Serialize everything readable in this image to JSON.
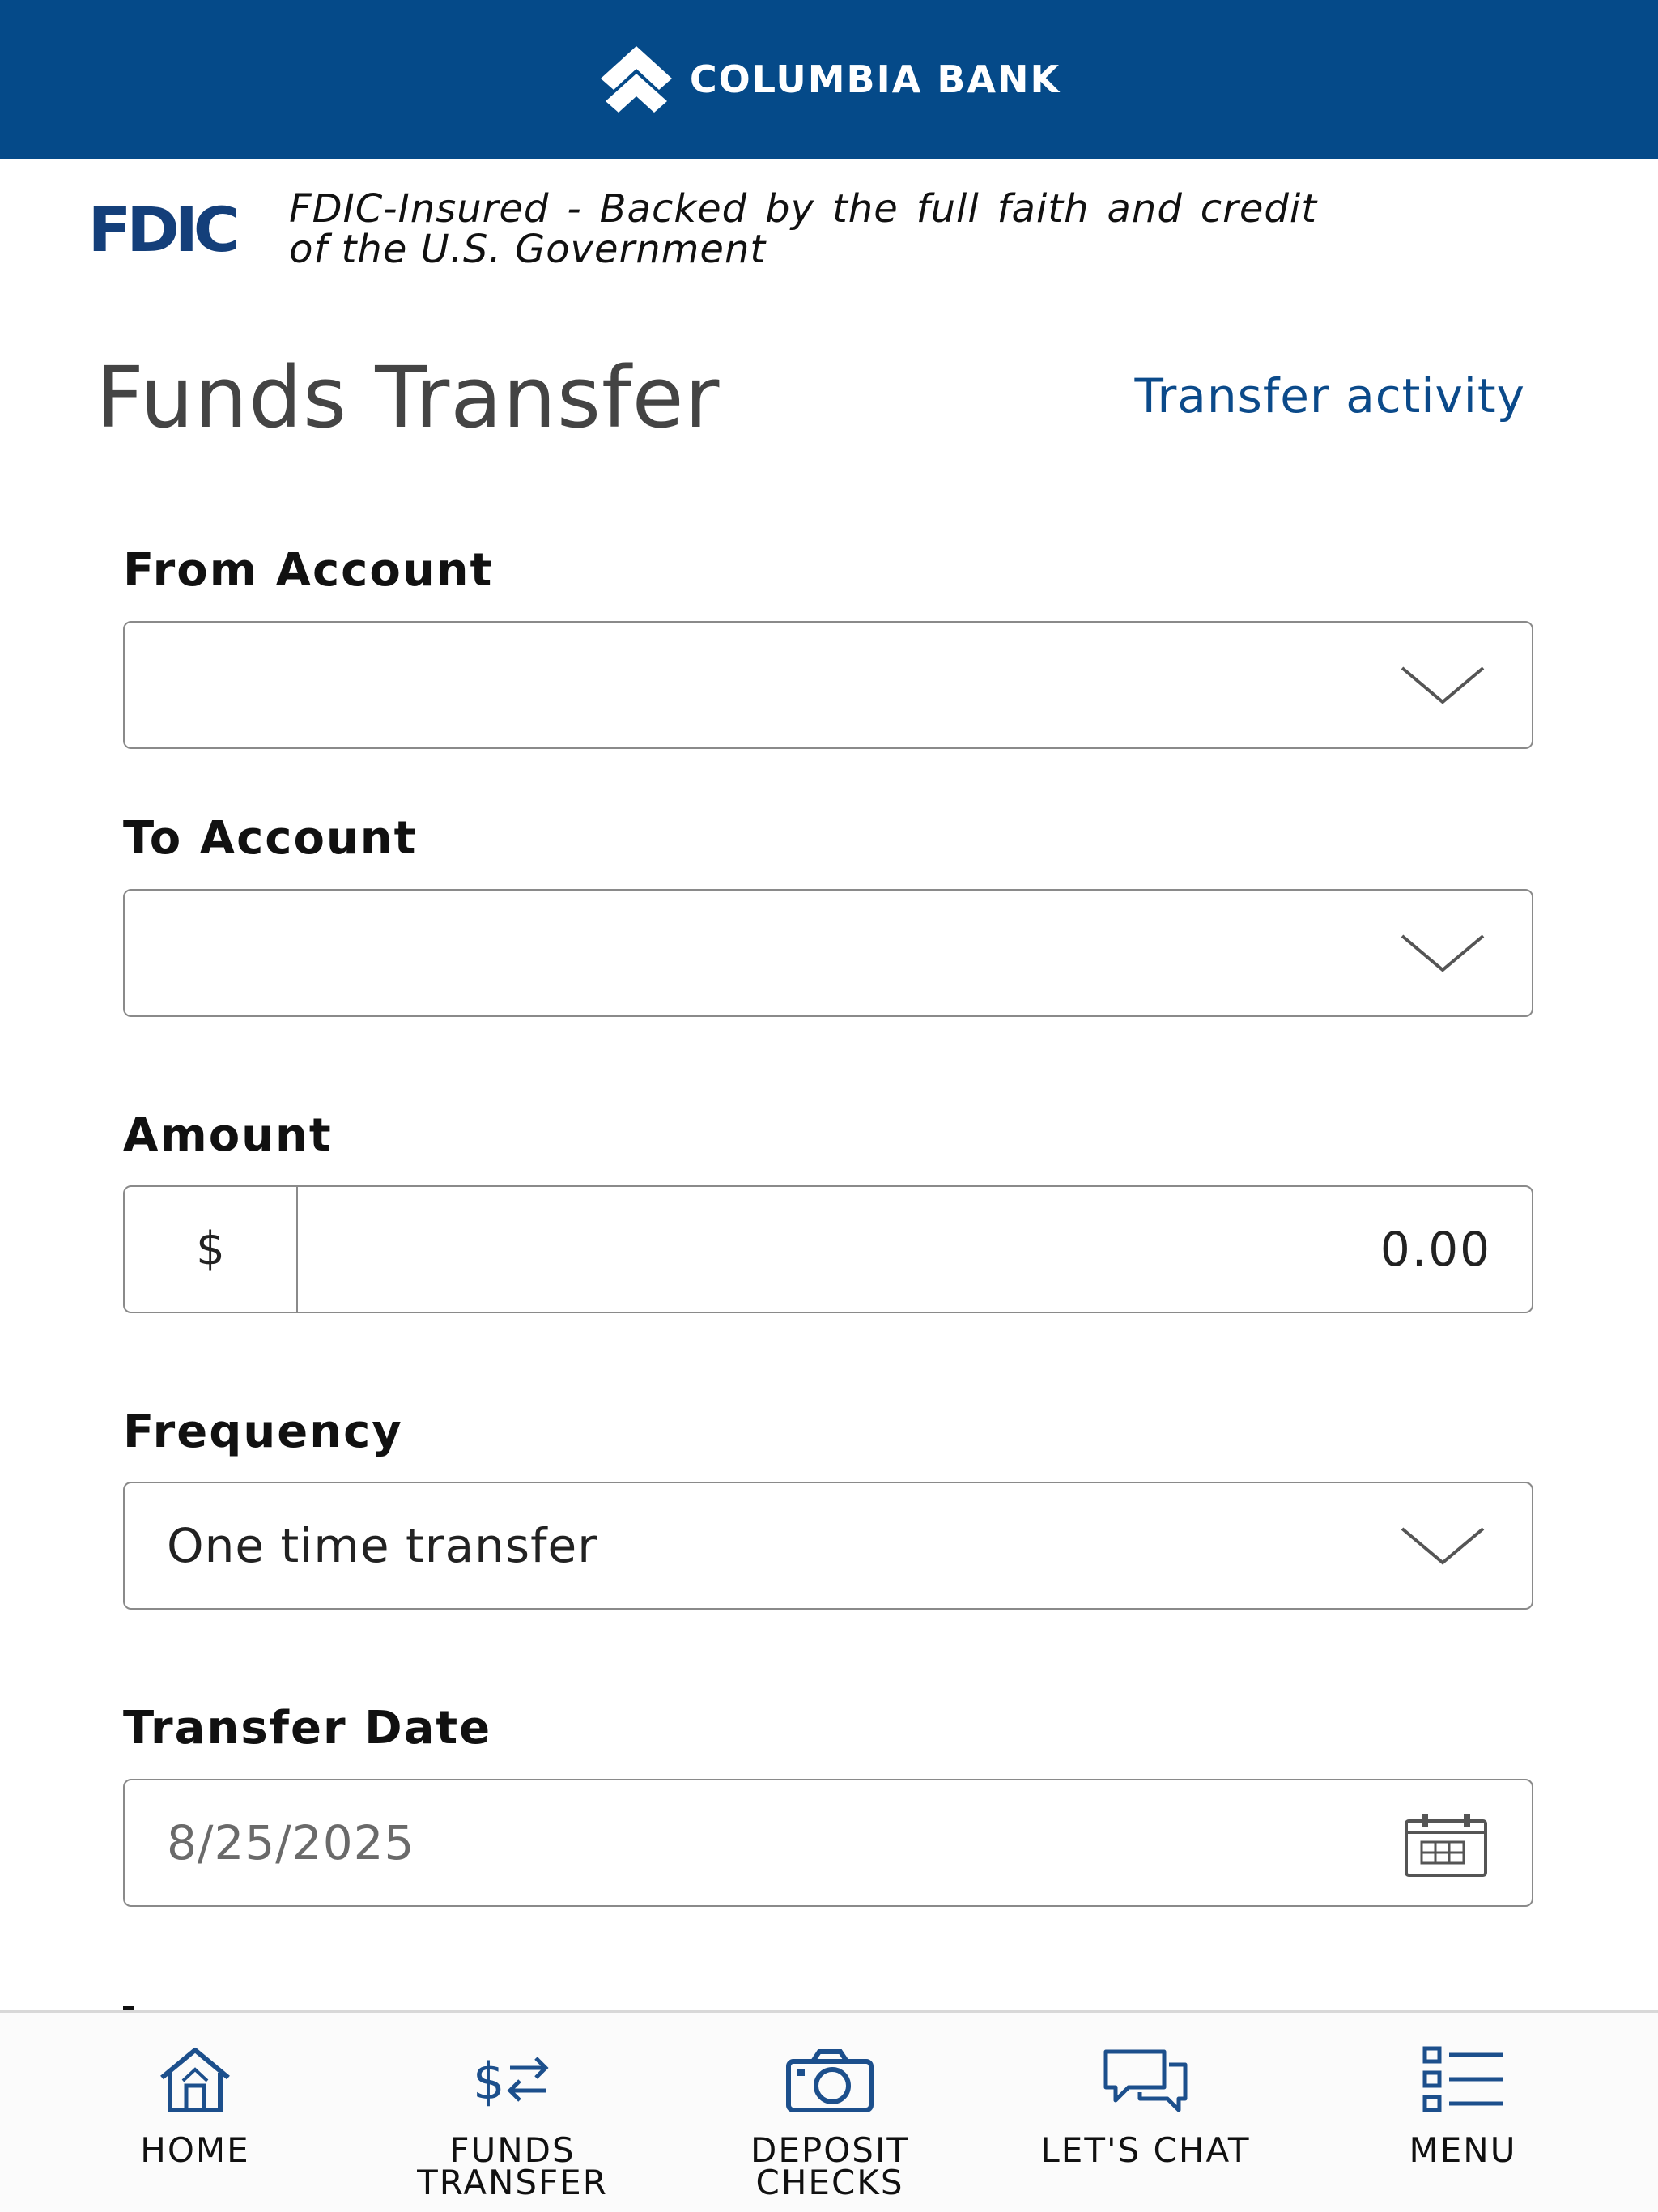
{
  "header": {
    "brand_name": "COLUMBIA BANK"
  },
  "fdic": {
    "logo_text": "FDIC",
    "notice": "FDIC-Insured - Backed by the full faith and credit of the U.S. Government"
  },
  "page": {
    "title": "Funds Transfer",
    "activity_link": "Transfer activity"
  },
  "form": {
    "from_account": {
      "label": "From Account",
      "value": ""
    },
    "to_account": {
      "label": "To Account",
      "value": ""
    },
    "amount": {
      "label": "Amount",
      "currency_symbol": "$",
      "value": "0.00"
    },
    "frequency": {
      "label": "Frequency",
      "value": "One time transfer"
    },
    "transfer_date": {
      "label": "Transfer Date",
      "value": "8/25/2025"
    }
  },
  "nav": {
    "items": [
      {
        "label": "HOME",
        "icon": "home-icon"
      },
      {
        "label": "FUNDS\nTRANSFER",
        "icon": "funds-transfer-icon"
      },
      {
        "label": "DEPOSIT\nCHECKS",
        "icon": "camera-icon"
      },
      {
        "label": "LET'S CHAT",
        "icon": "chat-icon"
      },
      {
        "label": "MENU",
        "icon": "menu-list-icon"
      }
    ]
  },
  "colors": {
    "header_bg": "#054a89",
    "link": "#0b4a8a",
    "nav_icon": "#1c4f8c"
  }
}
